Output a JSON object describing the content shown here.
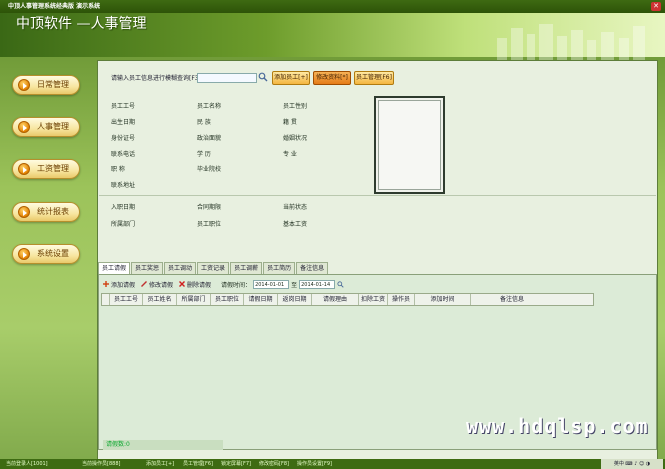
{
  "window": {
    "title": "中顶人事管理系统经典版 演示系统",
    "close_glyph": "✕"
  },
  "header": {
    "app_title": "中顶软件 —人事管理"
  },
  "nav": [
    {
      "label": "日常管理"
    },
    {
      "label": "人事管理"
    },
    {
      "label": "工资管理"
    },
    {
      "label": "统计报表"
    },
    {
      "label": "系统设置"
    }
  ],
  "search": {
    "label": "请输入员工信息进行模糊查询[F3]",
    "value": "",
    "icon": "search-icon"
  },
  "toolbar": {
    "add_employee": "添加员工[+]",
    "edit_info": "修改资料[*]",
    "employee_manage": "员工管理[F6]"
  },
  "fields": {
    "col1": [
      "员工工号",
      "出生日期",
      "身份证号",
      "联系电话",
      "职      称",
      "联系地址"
    ],
    "col2": [
      "员工名称",
      "民      族",
      "政治面貌",
      "学      历",
      "毕业院校"
    ],
    "col3": [
      "员工性别",
      "籍      贯",
      "婚姻状况",
      "专      业"
    ]
  },
  "fields2": {
    "col1": [
      "入职日期",
      "所属部门"
    ],
    "col2": [
      "合同期限",
      "员工职位"
    ],
    "col3": [
      "当前状态",
      "基本工资"
    ]
  },
  "tabs": [
    "员工请假",
    "员工奖惩",
    "员工调动",
    "工资记录",
    "员工调薪",
    "员工简历",
    "备注信息"
  ],
  "subtoolbar": {
    "add": "添加请假",
    "edit": "修改请假",
    "delete": "删除请假",
    "date_label": "请假时间：",
    "date_from": "2014-01-01",
    "to": "至",
    "date_to": "2014-01-14"
  },
  "table": {
    "columns": [
      "员工工号",
      "员工姓名",
      "所属部门",
      "员工职位",
      "请假日期",
      "返岗日期",
      "请假理由",
      "扣除工资",
      "操作员",
      "添加时间",
      "备注信息"
    ]
  },
  "footer": {
    "count": "请假数:0"
  },
  "watermark": "www.hdqlsp.com",
  "status": {
    "user": "当前登录人[1001]",
    "operator": "当前操作员[888]",
    "shortcut1": "添加员工[+]",
    "shortcut2": "员工管理[F6]",
    "shortcut3": "锁定屏幕[F7]",
    "shortcut4": "修改密码[F8]",
    "shortcut5": "操作员设置[F9]",
    "tray": "英中 ⌨ ♪ ☺ ◑"
  },
  "colors": {
    "accent": "#3e6b12",
    "button": "#f4b640",
    "panel": "#e8f0e0"
  }
}
